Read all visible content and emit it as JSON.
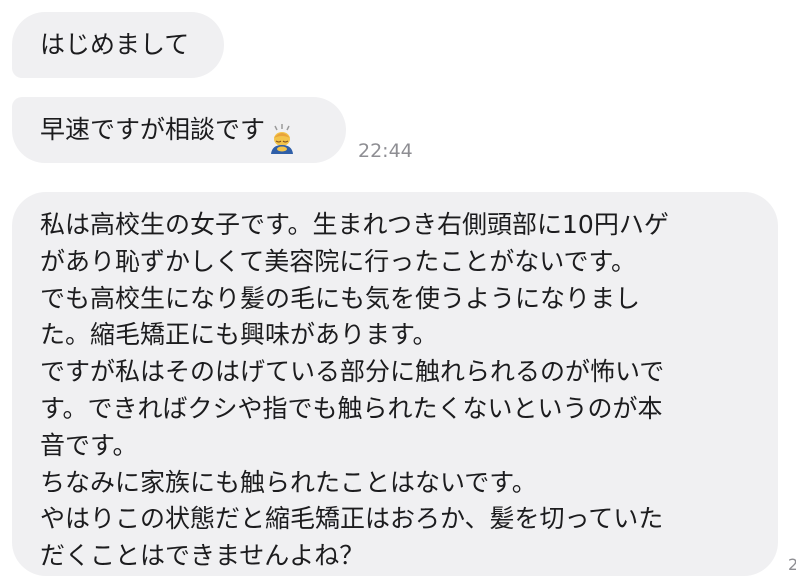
{
  "messages": [
    {
      "text": "はじめまして"
    },
    {
      "text": "早速ですが相談です",
      "emoji": "person-bowing-emoji",
      "timestamp": "22:44"
    },
    {
      "lines": [
        "私は高校生の女子です。生まれつき右側頭部に10円ハゲ",
        "があり恥ずかしくて美容院に行ったことがないです。",
        "でも高校生になり髪の毛にも気を使うようになりまし",
        "た。縮毛矯正にも興味があります。",
        "ですが私はそのはげている部分に触れられるのが怖いで",
        "す。できればクシや指でも触られたくないというのが本",
        "音です。",
        "ちなみに家族にも触られたことはないです。",
        "やはりこの状態だと縮毛矯正はおろか、髪を切っていた",
        "だくことはできませんよね？"
      ]
    }
  ],
  "edge_mark": "2",
  "colors": {
    "bubble_bg": "#f0f0f2",
    "text": "#1c1c1e",
    "timestamp": "#8e8e93"
  }
}
